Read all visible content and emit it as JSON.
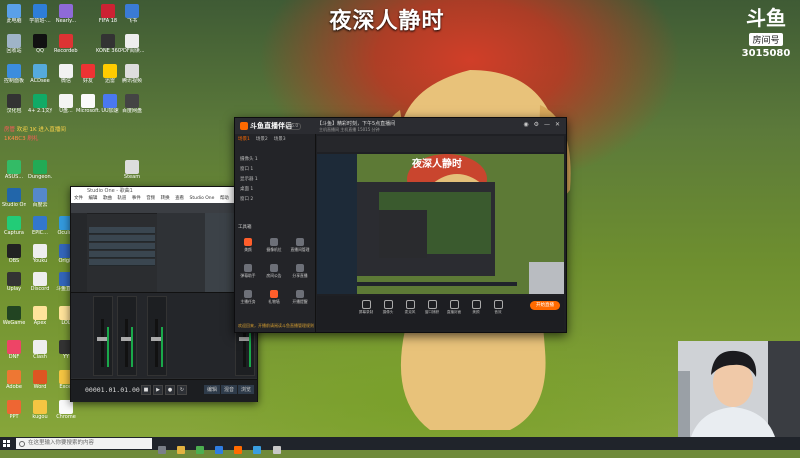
{
  "overlay": {
    "title": "夜深人静时"
  },
  "douyu": {
    "logo": "斗鱼",
    "label": "房间号",
    "room_number": "3015080"
  },
  "desktop": {
    "icons": [
      "此电脑",
      "学前班-...",
      "Nearly...",
      "FIFA 18",
      "飞书",
      "回收站",
      "QQ",
      "Recordeb...",
      "KONE 360",
      "PDF阅读...",
      "控制面板",
      "ACDsee",
      "微信",
      "好友",
      "迅雷",
      "腾讯视频",
      "汉化包",
      "4+ 2.1文件...",
      "U盘...",
      "Microsoft...",
      "UU加速",
      "百度网盘",
      "ASUS...",
      "Dungeon...",
      "Steam",
      "Studio One",
      "百度云",
      "Captura",
      "EPIC...",
      "Oculus",
      "OBS",
      "Youku",
      "Origin",
      "Uplay",
      "Discord",
      "斗鱼直播",
      "WeGame",
      "Apex",
      "LOL",
      "DNF",
      "Clash",
      "YY",
      "Adobe",
      "Word",
      "Excel",
      "PPT",
      "kugou",
      "Chrome"
    ],
    "chat": [
      {
        "user": "房管",
        "text": "欢迎 1K 进入直播间"
      },
      {
        "user": "1K4BC3",
        "text": "刷礼"
      }
    ]
  },
  "studio_one": {
    "title": "Studio One - 歌曲1",
    "menu": [
      "文件",
      "编辑",
      "歌曲",
      "轨道",
      "事件",
      "音频",
      "转换",
      "查看",
      "Studio One",
      "帮助"
    ],
    "timecode": "00001.01.01.00",
    "tabs": [
      "编辑",
      "混音",
      "浏览"
    ]
  },
  "stream_app": {
    "logo": "斗鱼直播伴侣",
    "version": "V6.0",
    "room_title": "【斗鱼】精彩时刻，下午5点直播间",
    "room_sub": "主机直播间  主机直播  15015 分钟",
    "scene_tabs": [
      "场景1",
      "场景2",
      "场景3"
    ],
    "sources": [
      "摄像头 1",
      "窗口 1",
      "显示器 1",
      "桌面 1",
      "窗口 2"
    ],
    "toolbox_label": "工具箱",
    "tools": [
      "美颜",
      "摄像机位",
      "直播间管理",
      "弹幕助手",
      "房间公告",
      "分享直播",
      "主播任务",
      "礼物墙",
      "开播提醒"
    ],
    "notice": "欢迎回来，开播前请阅读斗鱼直播管理规则",
    "bottom_tools": [
      "屏幕录制",
      "摄像头",
      "麦克风",
      "窗口捕获",
      "直播封面",
      "美颜",
      "音效"
    ],
    "start_button": "开始直播"
  },
  "taskbar": {
    "search_placeholder": "在这里输入你要搜索的内容"
  },
  "colors": {
    "accent": "#ff6a00",
    "taskbar": "#20242b"
  }
}
